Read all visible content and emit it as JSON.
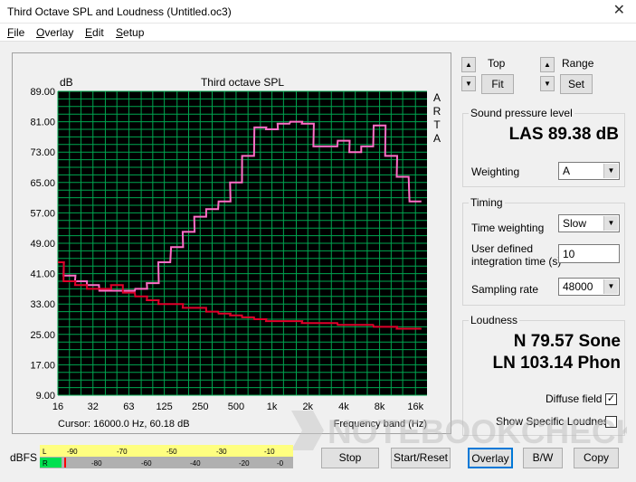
{
  "window": {
    "title": "Third Octave SPL and Loudness (Untitled.oc3)",
    "close_glyph": "✕"
  },
  "menu": [
    {
      "label": "File"
    },
    {
      "label": "Overlay"
    },
    {
      "label": "Edit"
    },
    {
      "label": "Setup"
    }
  ],
  "graph": {
    "ylabel": "dB",
    "title": "Third octave SPL",
    "side_text": [
      "A",
      "R",
      "T",
      "A"
    ],
    "cursor_text": "Cursor: 16000.0 Hz, 60.18 dB",
    "xlabel": "Frequency band (Hz)",
    "colors": {
      "background": "#000000",
      "grid": "#00a650",
      "pink": "#ff6ec7",
      "red": "#e0002a"
    }
  },
  "chart_data": {
    "type": "line",
    "title": "Third octave SPL",
    "xlabel": "Frequency band (Hz)",
    "ylabel": "dB",
    "ylim": [
      9,
      89
    ],
    "yticks": [
      "89.00",
      "81.00",
      "73.00",
      "65.00",
      "57.00",
      "49.00",
      "41.00",
      "33.00",
      "25.00",
      "17.00",
      "9.00"
    ],
    "xticks": [
      "16",
      "32",
      "63",
      "125",
      "250",
      "500",
      "1k",
      "2k",
      "4k",
      "8k",
      "16k"
    ],
    "x": [
      16,
      20,
      25,
      31.5,
      40,
      50,
      63,
      80,
      100,
      125,
      160,
      200,
      250,
      315,
      400,
      500,
      630,
      800,
      1000,
      1250,
      1600,
      2000,
      2500,
      3150,
      4000,
      5000,
      6300,
      8000,
      10000,
      12500,
      16000
    ],
    "grid": true,
    "series": [
      {
        "color": "#ff6ec7",
        "values": [
          44.0,
          40.5,
          39.0,
          38.0,
          36.5,
          36.5,
          36.5,
          37.0,
          38.5,
          44.0,
          48.0,
          52.0,
          56.0,
          58.0,
          60.0,
          65.0,
          72.0,
          79.5,
          79.0,
          80.5,
          81.0,
          80.5,
          74.5,
          74.5,
          76.0,
          73.0,
          74.5,
          80.0,
          72.0,
          66.5,
          60.0
        ]
      },
      {
        "color": "#e0002a",
        "values": [
          44.0,
          39.0,
          38.0,
          37.0,
          37.0,
          38.0,
          36.0,
          35.0,
          34.0,
          33.0,
          33.0,
          32.0,
          32.0,
          31.0,
          30.5,
          30.0,
          29.5,
          29.0,
          28.5,
          28.5,
          28.5,
          28.0,
          28.0,
          28.0,
          27.5,
          27.5,
          27.5,
          27.0,
          27.0,
          26.5,
          26.5
        ]
      }
    ]
  },
  "controls": {
    "top_label": "Top",
    "fit_label": "Fit",
    "range_label": "Range",
    "set_label": "Set",
    "up_glyph": "▲",
    "down_glyph": "▼"
  },
  "spl": {
    "group_title": "Sound pressure level",
    "value": "LAS 89.38 dB",
    "weighting_label": "Weighting",
    "weighting_value": "A"
  },
  "timing": {
    "group_title": "Timing",
    "time_weighting_label": "Time weighting",
    "time_weighting_value": "Slow",
    "integration_label_1": "User defined",
    "integration_label_2": "integration time (s)",
    "integration_value": "10",
    "sampling_label": "Sampling rate",
    "sampling_value": "48000"
  },
  "loudness": {
    "group_title": "Loudness",
    "sone": "N 79.57 Sone",
    "phon": "LN 103.14 Phon",
    "diffuse_label": "Diffuse field",
    "diffuse_checked": "✓",
    "specific_label": "Show Specific Loudness"
  },
  "meter": {
    "label": "dBFS",
    "channel_top": "L",
    "channel_bottom": "R",
    "top_scale": [
      "-90",
      "-70",
      "-50",
      "-30",
      "-10"
    ],
    "bottom_scale": [
      "-80",
      "-60",
      "-40",
      "-20",
      "-0"
    ],
    "colors": {
      "bar": "#ffff80",
      "level": "#00e050",
      "peak": "#ff0000"
    }
  },
  "buttons": {
    "stop": "Stop",
    "start_reset": "Start/Reset",
    "overlay": "Overlay",
    "bw": "B/W",
    "copy": "Copy"
  },
  "watermark": "NOTEBOOKCHECK"
}
